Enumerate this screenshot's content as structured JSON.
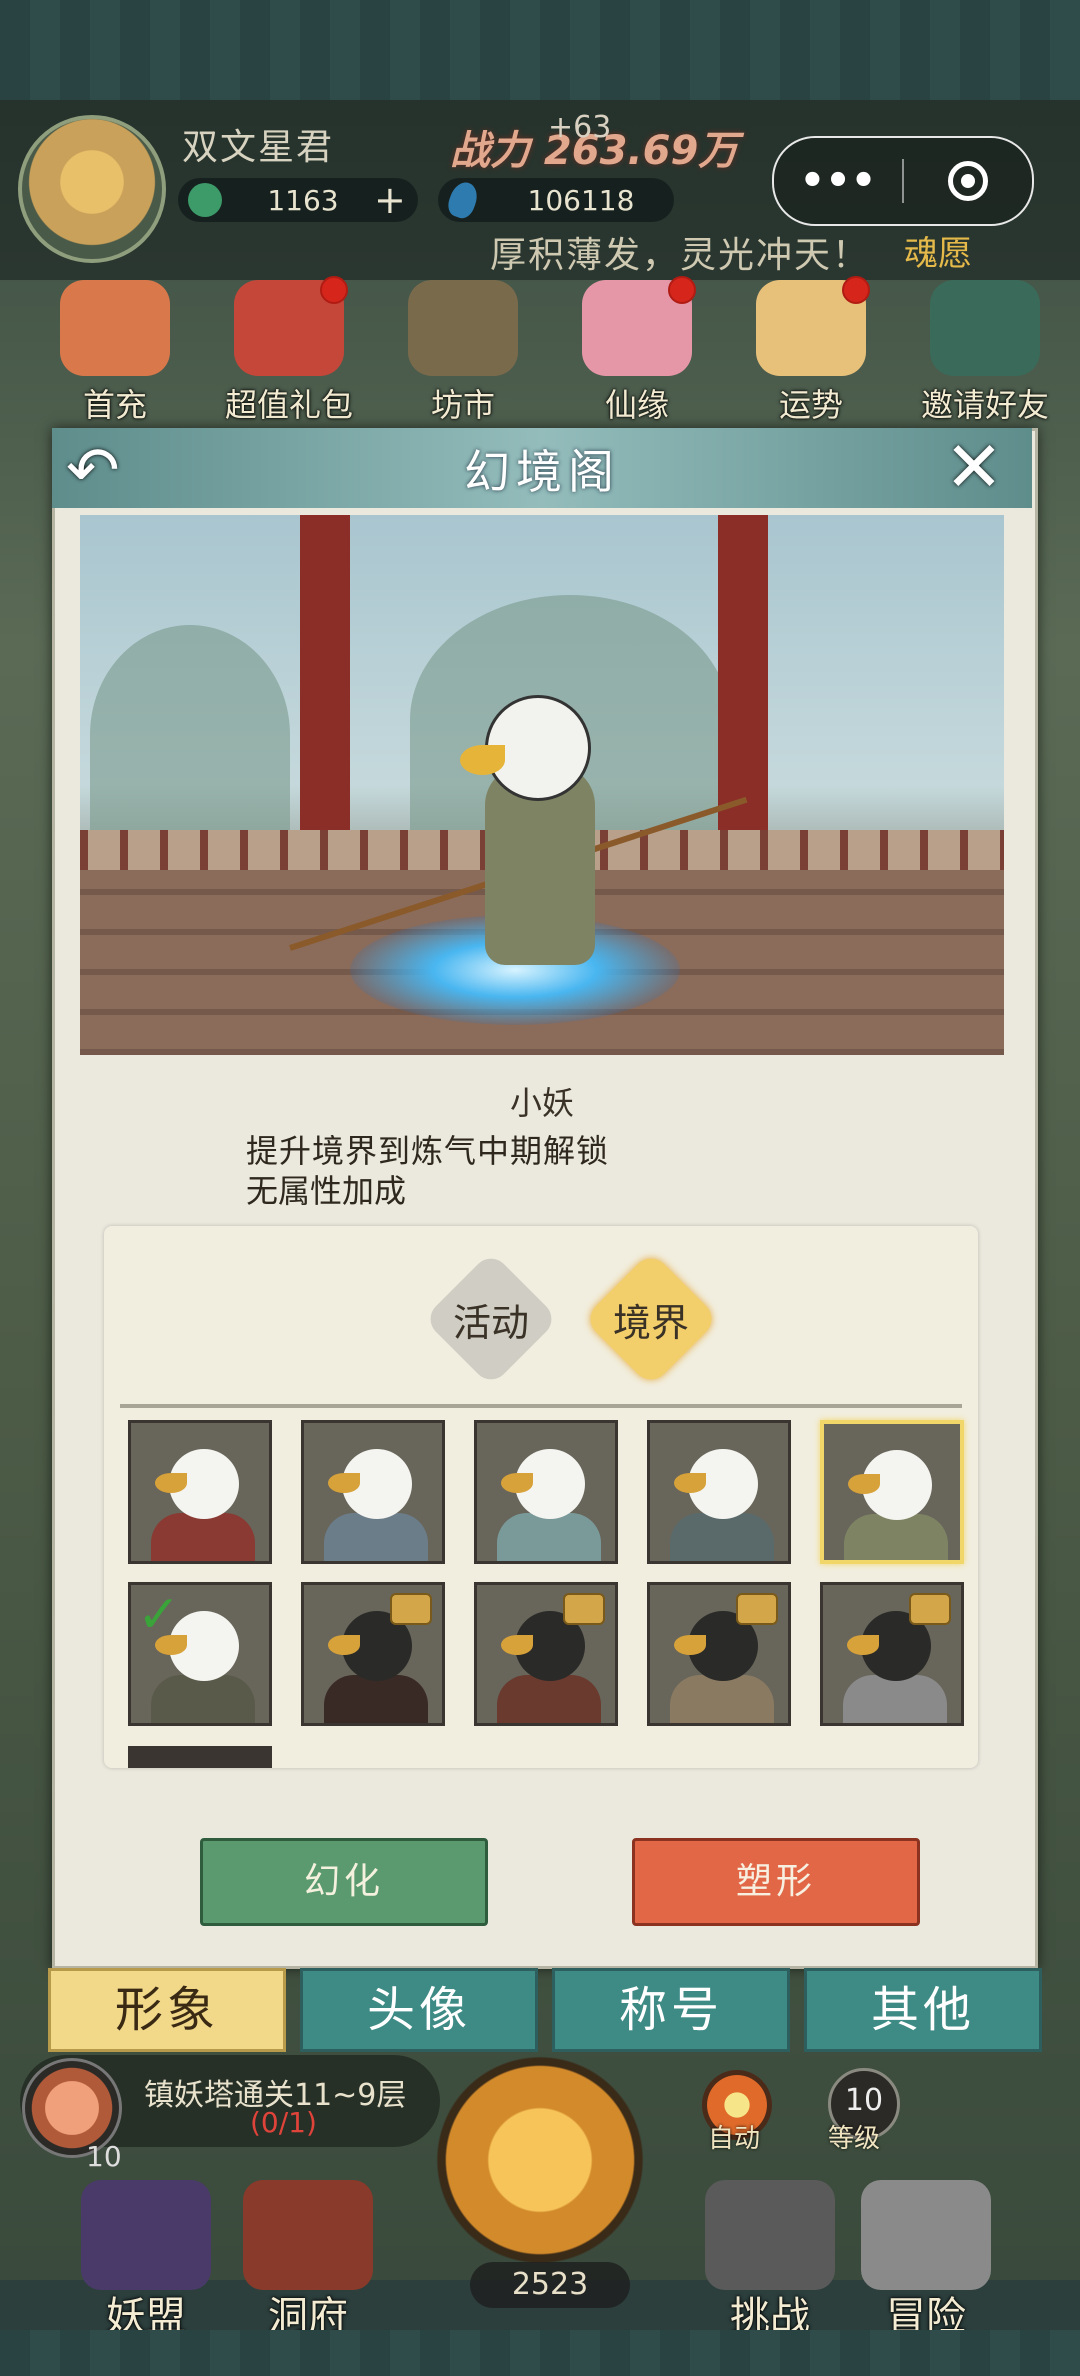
{
  "player": {
    "name": "双文星君",
    "power_delta": "+63",
    "power": "战力 263.69万"
  },
  "currency": {
    "jade": "1163",
    "jade_add": "+",
    "gems": "106118"
  },
  "mini_program": {
    "more": "•••"
  },
  "marquee": {
    "text": "厚积薄发，灵光冲天！",
    "tag": "魂愿"
  },
  "top_nav": [
    {
      "label": "首充",
      "badge": false,
      "color": "#d9784a"
    },
    {
      "label": "超值礼包",
      "badge": true,
      "color": "#c5473a"
    },
    {
      "label": "坊市",
      "badge": false,
      "color": "#7a6a4c"
    },
    {
      "label": "仙缘",
      "badge": true,
      "color": "#e597a8"
    },
    {
      "label": "运势",
      "badge": true,
      "color": "#e7c07a"
    },
    {
      "label": "邀请好友",
      "badge": false,
      "color": "#3a6a5a"
    }
  ],
  "panel": {
    "title": "幻境阁",
    "back": "↶",
    "close": "✕",
    "character": {
      "name": "小妖",
      "unlock": "提升境界到炼气中期解锁",
      "attribute": "无属性加成"
    },
    "type_tabs": [
      {
        "label": "活动",
        "active": false
      },
      {
        "label": "境界",
        "active": true
      }
    ],
    "skins": [
      {
        "row": 0,
        "col": 0,
        "face": "#f4f4f0",
        "body": "#8a3a32",
        "locked": false,
        "selected": false,
        "owned": false
      },
      {
        "row": 0,
        "col": 1,
        "face": "#f4f4f0",
        "body": "#6c7d8a",
        "locked": false,
        "selected": false,
        "owned": false
      },
      {
        "row": 0,
        "col": 2,
        "face": "#f4f4f0",
        "body": "#7a9a9a",
        "locked": false,
        "selected": false,
        "owned": false
      },
      {
        "row": 0,
        "col": 3,
        "face": "#f4f4f0",
        "body": "#5a6a6a",
        "locked": false,
        "selected": false,
        "owned": false
      },
      {
        "row": 0,
        "col": 4,
        "face": "#f4f4f0",
        "body": "#7e8463",
        "locked": false,
        "selected": true,
        "owned": false
      },
      {
        "row": 1,
        "col": 0,
        "face": "#f4f4f0",
        "body": "#5a5a4a",
        "locked": false,
        "selected": false,
        "owned": true
      },
      {
        "row": 1,
        "col": 1,
        "face": "#2a2a28",
        "body": "#3a2a26",
        "locked": true,
        "selected": false,
        "owned": false
      },
      {
        "row": 1,
        "col": 2,
        "face": "#2a2a28",
        "body": "#6a3a2e",
        "locked": true,
        "selected": false,
        "owned": false
      },
      {
        "row": 1,
        "col": 3,
        "face": "#2a2a28",
        "body": "#8a7a62",
        "locked": true,
        "selected": false,
        "owned": false
      },
      {
        "row": 1,
        "col": 4,
        "face": "#2a2a28",
        "body": "#8a8a8a",
        "locked": true,
        "selected": false,
        "owned": false
      }
    ],
    "btn_transform": "幻化",
    "btn_reshape": "塑形"
  },
  "bottom_tabs": [
    {
      "label": "形象",
      "active": true
    },
    {
      "label": "头像",
      "active": false
    },
    {
      "label": "称号",
      "active": false
    },
    {
      "label": "其他",
      "active": false
    }
  ],
  "quest": {
    "text": "镇妖塔通关11~9层",
    "progress": "(0/1)",
    "level": "10"
  },
  "auto": {
    "label": "自动"
  },
  "level": {
    "value": "10",
    "label": "等级"
  },
  "coins": "2523",
  "bottom_nav": [
    {
      "label": "妖盟",
      "color": "#4a3a6a"
    },
    {
      "label": "洞府",
      "color": "#8a3a2a"
    },
    {
      "label": "挑战",
      "color": "#5a5a5a"
    },
    {
      "label": "冒险",
      "color": "#8a8a8a"
    }
  ],
  "colors": {
    "panel_header": "#6a9a98",
    "accent_gold": "#f1d66a",
    "btn_green": "#5b9a6f",
    "btn_red": "#e16747"
  }
}
